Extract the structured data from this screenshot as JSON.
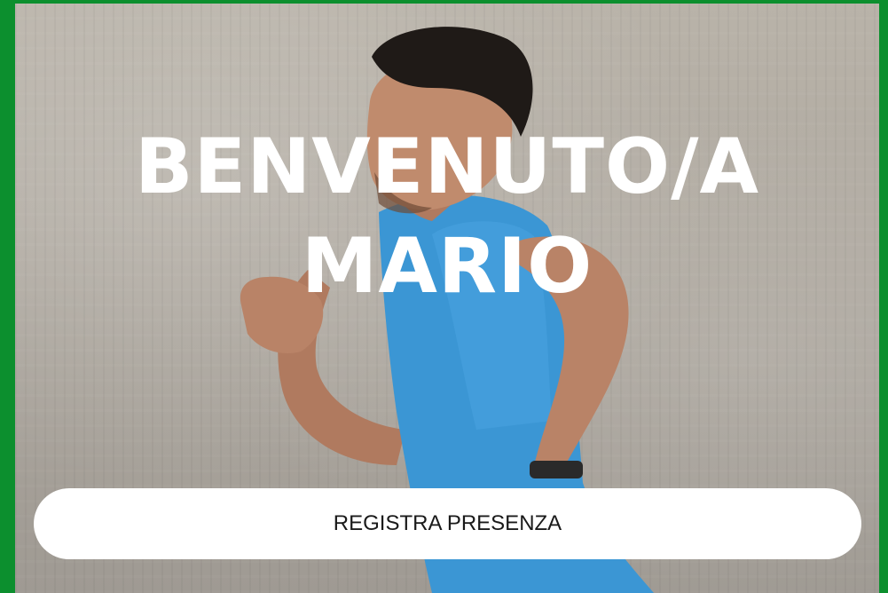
{
  "welcome": {
    "line1": "BENVENUTO/A",
    "line2": "MARIO"
  },
  "actions": {
    "register_label": "REGISTRA PRESENZA"
  },
  "background": {
    "photo_subject": "runner-in-blue-shirt"
  },
  "colors": {
    "frame_border": "#0c8f2e",
    "shirt": "#3b96d4",
    "button_bg": "#ffffff",
    "title_text": "#ffffff"
  }
}
